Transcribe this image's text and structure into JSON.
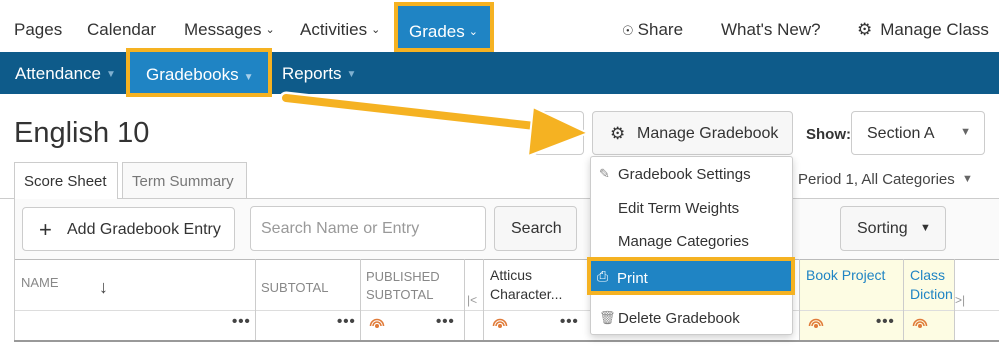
{
  "topnav": {
    "pages": "Pages",
    "calendar": "Calendar",
    "messages": "Messages",
    "activities": "Activities",
    "grades": "Grades",
    "share": "Share",
    "whats_new": "What's New?",
    "manage_class": "Manage Class"
  },
  "subnav": {
    "attendance": "Attendance",
    "gradebooks": "Gradebooks",
    "reports": "Reports"
  },
  "page": {
    "title": "English 10",
    "manage_gradebook": "Manage Gradebook",
    "show_label": "Show:",
    "section_value": "Section A"
  },
  "tabs": {
    "score_sheet": "Score Sheet",
    "term_summary": "Term Summary",
    "filter": "Period 1, All Categories"
  },
  "toolbar": {
    "add_entry": "Add Gradebook Entry",
    "search_placeholder": "Search Name or Entry",
    "search_button": "Search",
    "sorting": "Sorting"
  },
  "grid": {
    "col_name": "NAME",
    "col_subtotal": "SUBTOTAL",
    "col_published_1": "PUBLISHED",
    "col_published_2": "SUBTOTAL",
    "col_atticus_1": "Atticus",
    "col_atticus_2": "Character...",
    "col_book_project": "Book Project",
    "col_class_1": "Class",
    "col_class_2": "Diction",
    "dots": "•••"
  },
  "menu": {
    "settings": "Gradebook Settings",
    "term_weights": "Edit Term Weights",
    "categories": "Manage Categories",
    "print": "Print",
    "delete": "Delete Gradebook"
  },
  "colors": {
    "brand_blue": "#1f84c4",
    "nav_dark": "#0e5b8a",
    "highlight": "#f5b222",
    "rss_orange": "#e07b39"
  }
}
